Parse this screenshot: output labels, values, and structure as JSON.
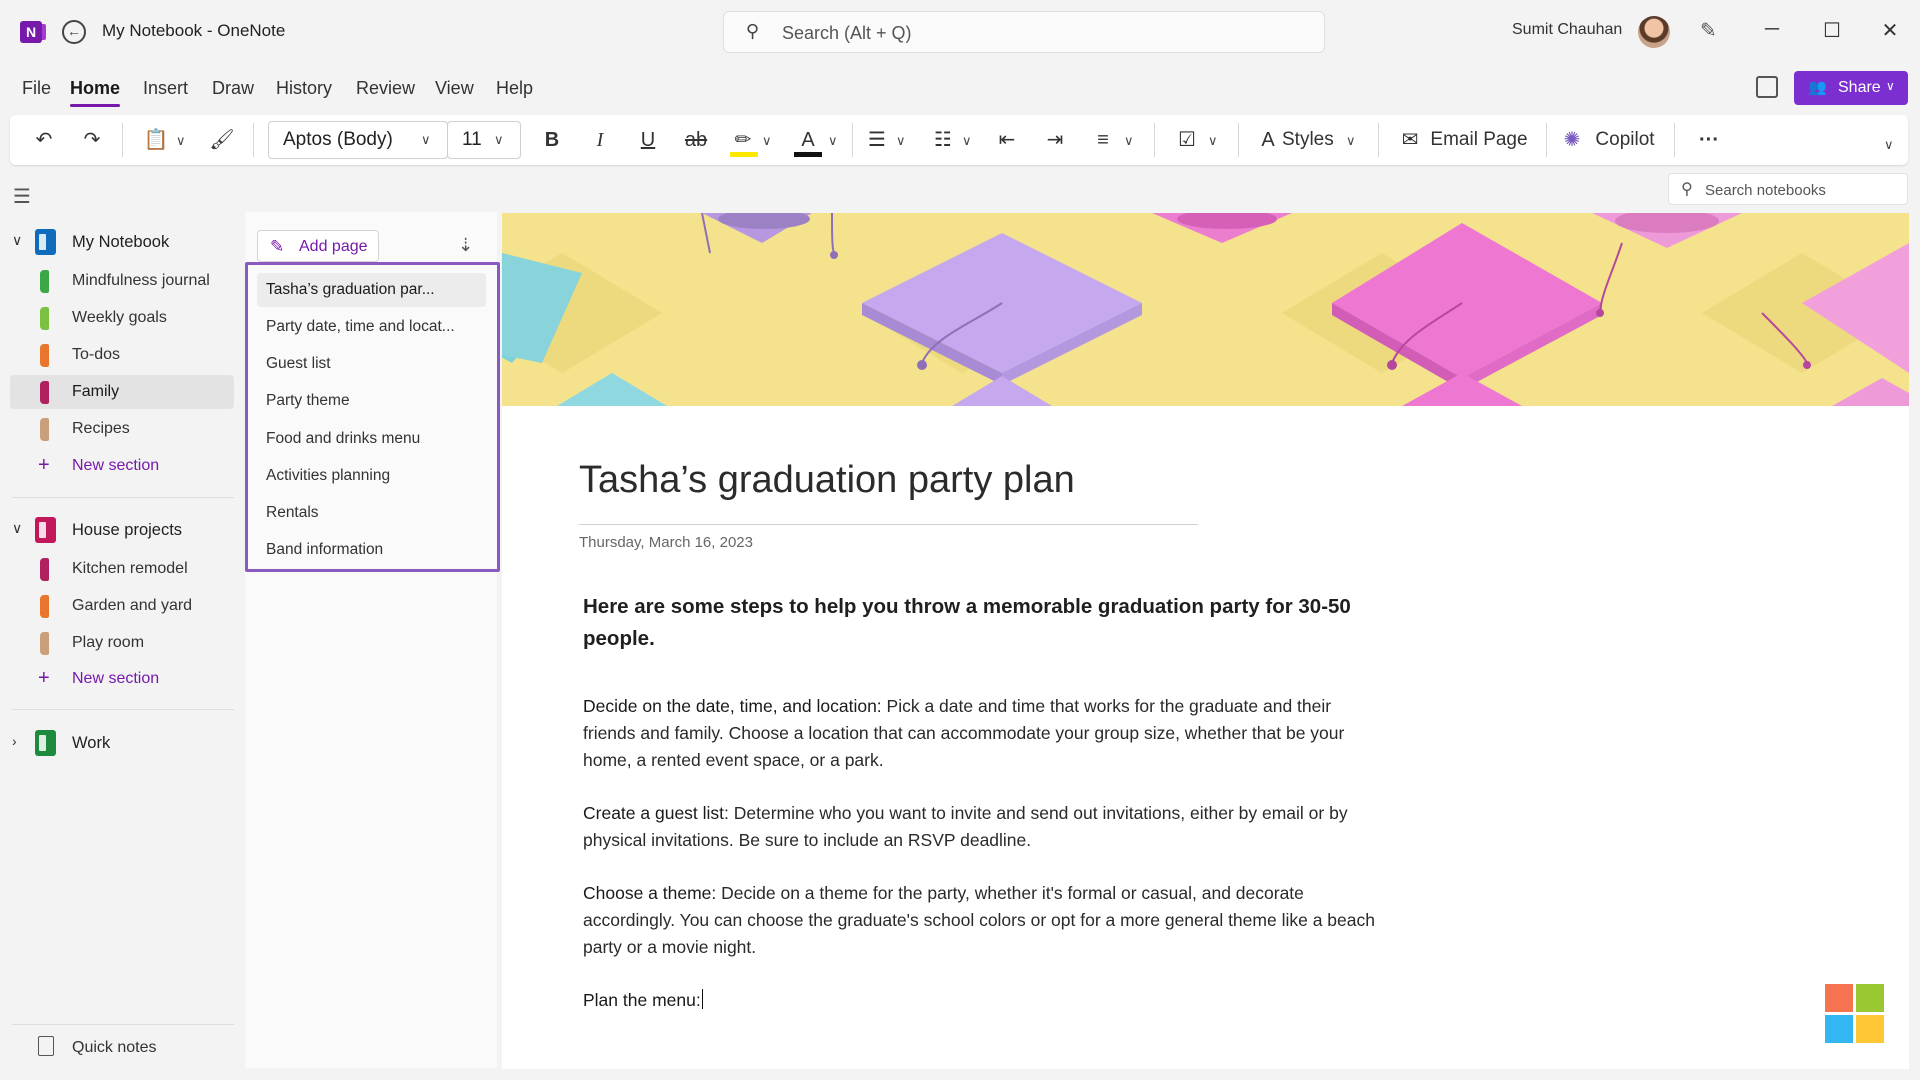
{
  "titlebar": {
    "app_title": "My Notebook - OneNote",
    "search_placeholder": "Search (Alt + Q)",
    "user_name": "Sumit Chauhan"
  },
  "menu": {
    "tabs": [
      "File",
      "Home",
      "Insert",
      "Draw",
      "History",
      "Review",
      "View",
      "Help"
    ],
    "active_tab": "Home",
    "share_label": "Share"
  },
  "ribbon": {
    "font_name": "Aptos (Body)",
    "font_size": "11",
    "styles_label": "Styles",
    "email_page_label": "Email Page",
    "copilot_label": "Copilot",
    "more_label": "···"
  },
  "notebooks_search_placeholder": "Search notebooks",
  "notebooks": [
    {
      "name": "My Notebook",
      "color": "#0f6cbd",
      "expanded": true,
      "sections": [
        {
          "name": "Mindfulness journal",
          "color": "#3aa845"
        },
        {
          "name": "Weekly goals",
          "color": "#7cc242"
        },
        {
          "name": "To-dos",
          "color": "#e8762c"
        },
        {
          "name": "Family",
          "color": "#b0215f",
          "selected": true
        },
        {
          "name": "Recipes",
          "color": "#c9a07a"
        }
      ],
      "new_section_label": "New section"
    },
    {
      "name": "House projects",
      "color": "#c2185b",
      "expanded": true,
      "sections": [
        {
          "name": "Kitchen remodel",
          "color": "#b0215f"
        },
        {
          "name": "Garden and yard",
          "color": "#e8762c"
        },
        {
          "name": "Play room",
          "color": "#c9a07a"
        }
      ],
      "new_section_label": "New section"
    },
    {
      "name": "Work",
      "color": "#1e8a3e",
      "expanded": false,
      "sections": []
    }
  ],
  "quick_notes_label": "Quick notes",
  "pages": {
    "add_page_label": "Add page",
    "items": [
      "Tasha’s graduation par...",
      "Party date, time and locat...",
      "Guest list",
      "Party theme",
      "Food and drinks menu",
      "Activities planning",
      "Rentals",
      "Band information"
    ],
    "selected_index": 0
  },
  "page": {
    "title": "Tasha’s graduation party plan",
    "date": "Thursday, March 16, 2023",
    "intro": "Here are some steps to help you throw a memorable graduation party for 30-50 people.",
    "paragraphs": [
      {
        "lead": "Decide on the date, time, and location:",
        "text": " Pick a date and time that works for the graduate and their friends and family. Choose a location that can accommodate your group size, whether that be your home, a rented event space, or a park."
      },
      {
        "lead": "Create a guest list:",
        "text": " Determine who you want to invite and send out invitations, either by email or by physical invitations. Be sure to include an RSVP deadline."
      },
      {
        "lead": "Choose a theme:",
        "text": " Decide on a theme for the party, whether it's formal or casual, and decorate accordingly. You can choose the graduate's school colors or opt for a more general theme like a beach party or a movie night."
      },
      {
        "lead": "Plan the menu:",
        "text": ""
      }
    ]
  },
  "colors": {
    "accent": "#7719aa",
    "share_button": "#7b2fd0",
    "page_list_border": "#8a5bbf",
    "banner_bg": "#f4e38c"
  }
}
